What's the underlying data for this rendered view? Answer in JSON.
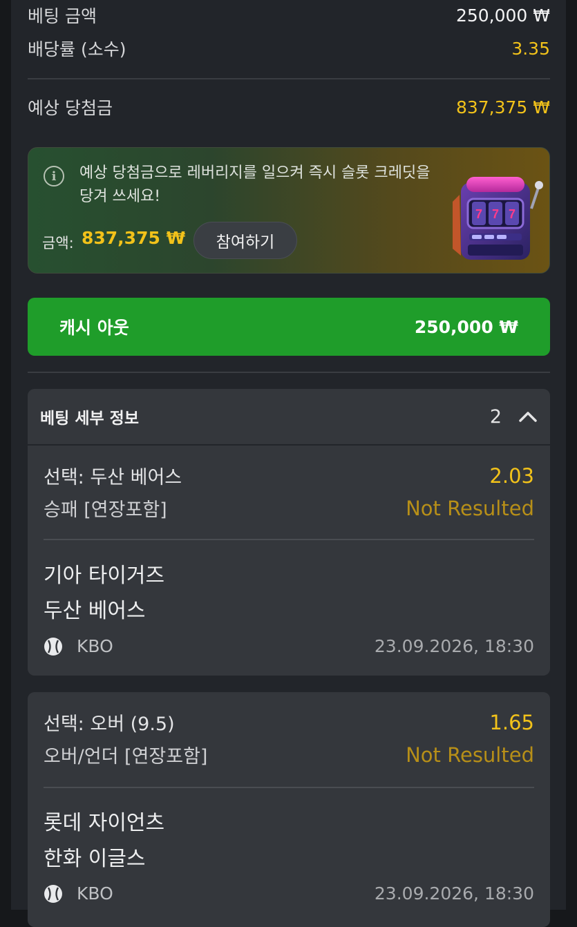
{
  "summary": {
    "bet_amount_label": "베팅 금액",
    "bet_amount_value": "250,000 ₩",
    "odds_label": "배당률 (소수)",
    "odds_value": "3.35",
    "expected_win_label": "예상 당첨금",
    "expected_win_value": "837,375 ₩"
  },
  "promo": {
    "message": "예상 당첨금으로 레버리지를 일으켜 즉시 슬롯 크레딧을 당겨 쓰세요!",
    "amount_label": "금액:",
    "amount_value": "837,375 ₩",
    "join_label": "참여하기",
    "icon": "info-icon",
    "image": "slot-machine-777"
  },
  "cashout": {
    "label": "캐시 아웃",
    "value": "250,000 ₩"
  },
  "details": {
    "title": "베팅 세부 정보",
    "count": "2",
    "toggle_icon": "chevron-up-icon"
  },
  "selections": [
    {
      "selection": "선택: 두산 베어스",
      "odds": "2.03",
      "market": "승패 [연장포함]",
      "status": "Not Resulted",
      "home": "기아 타이거즈",
      "away": "두산 베어스",
      "league": "KBO",
      "datetime": "23.09.2026, 18:30",
      "sport_icon": "baseball-icon"
    },
    {
      "selection": "선택: 오버 (9.5)",
      "odds": "1.65",
      "market": "오버/언더 [연장포함]",
      "status": "Not Resulted",
      "home": "롯데 자이언츠",
      "away": "한화 이글스",
      "league": "KBO",
      "datetime": "23.09.2026, 18:30",
      "sport_icon": "baseball-icon"
    }
  ],
  "colors": {
    "background": "#22252a",
    "accent_yellow": "#f2c21a",
    "status_yellow": "#b78f18",
    "cashout_green": "#1f9d2a",
    "card": "#34373c"
  }
}
